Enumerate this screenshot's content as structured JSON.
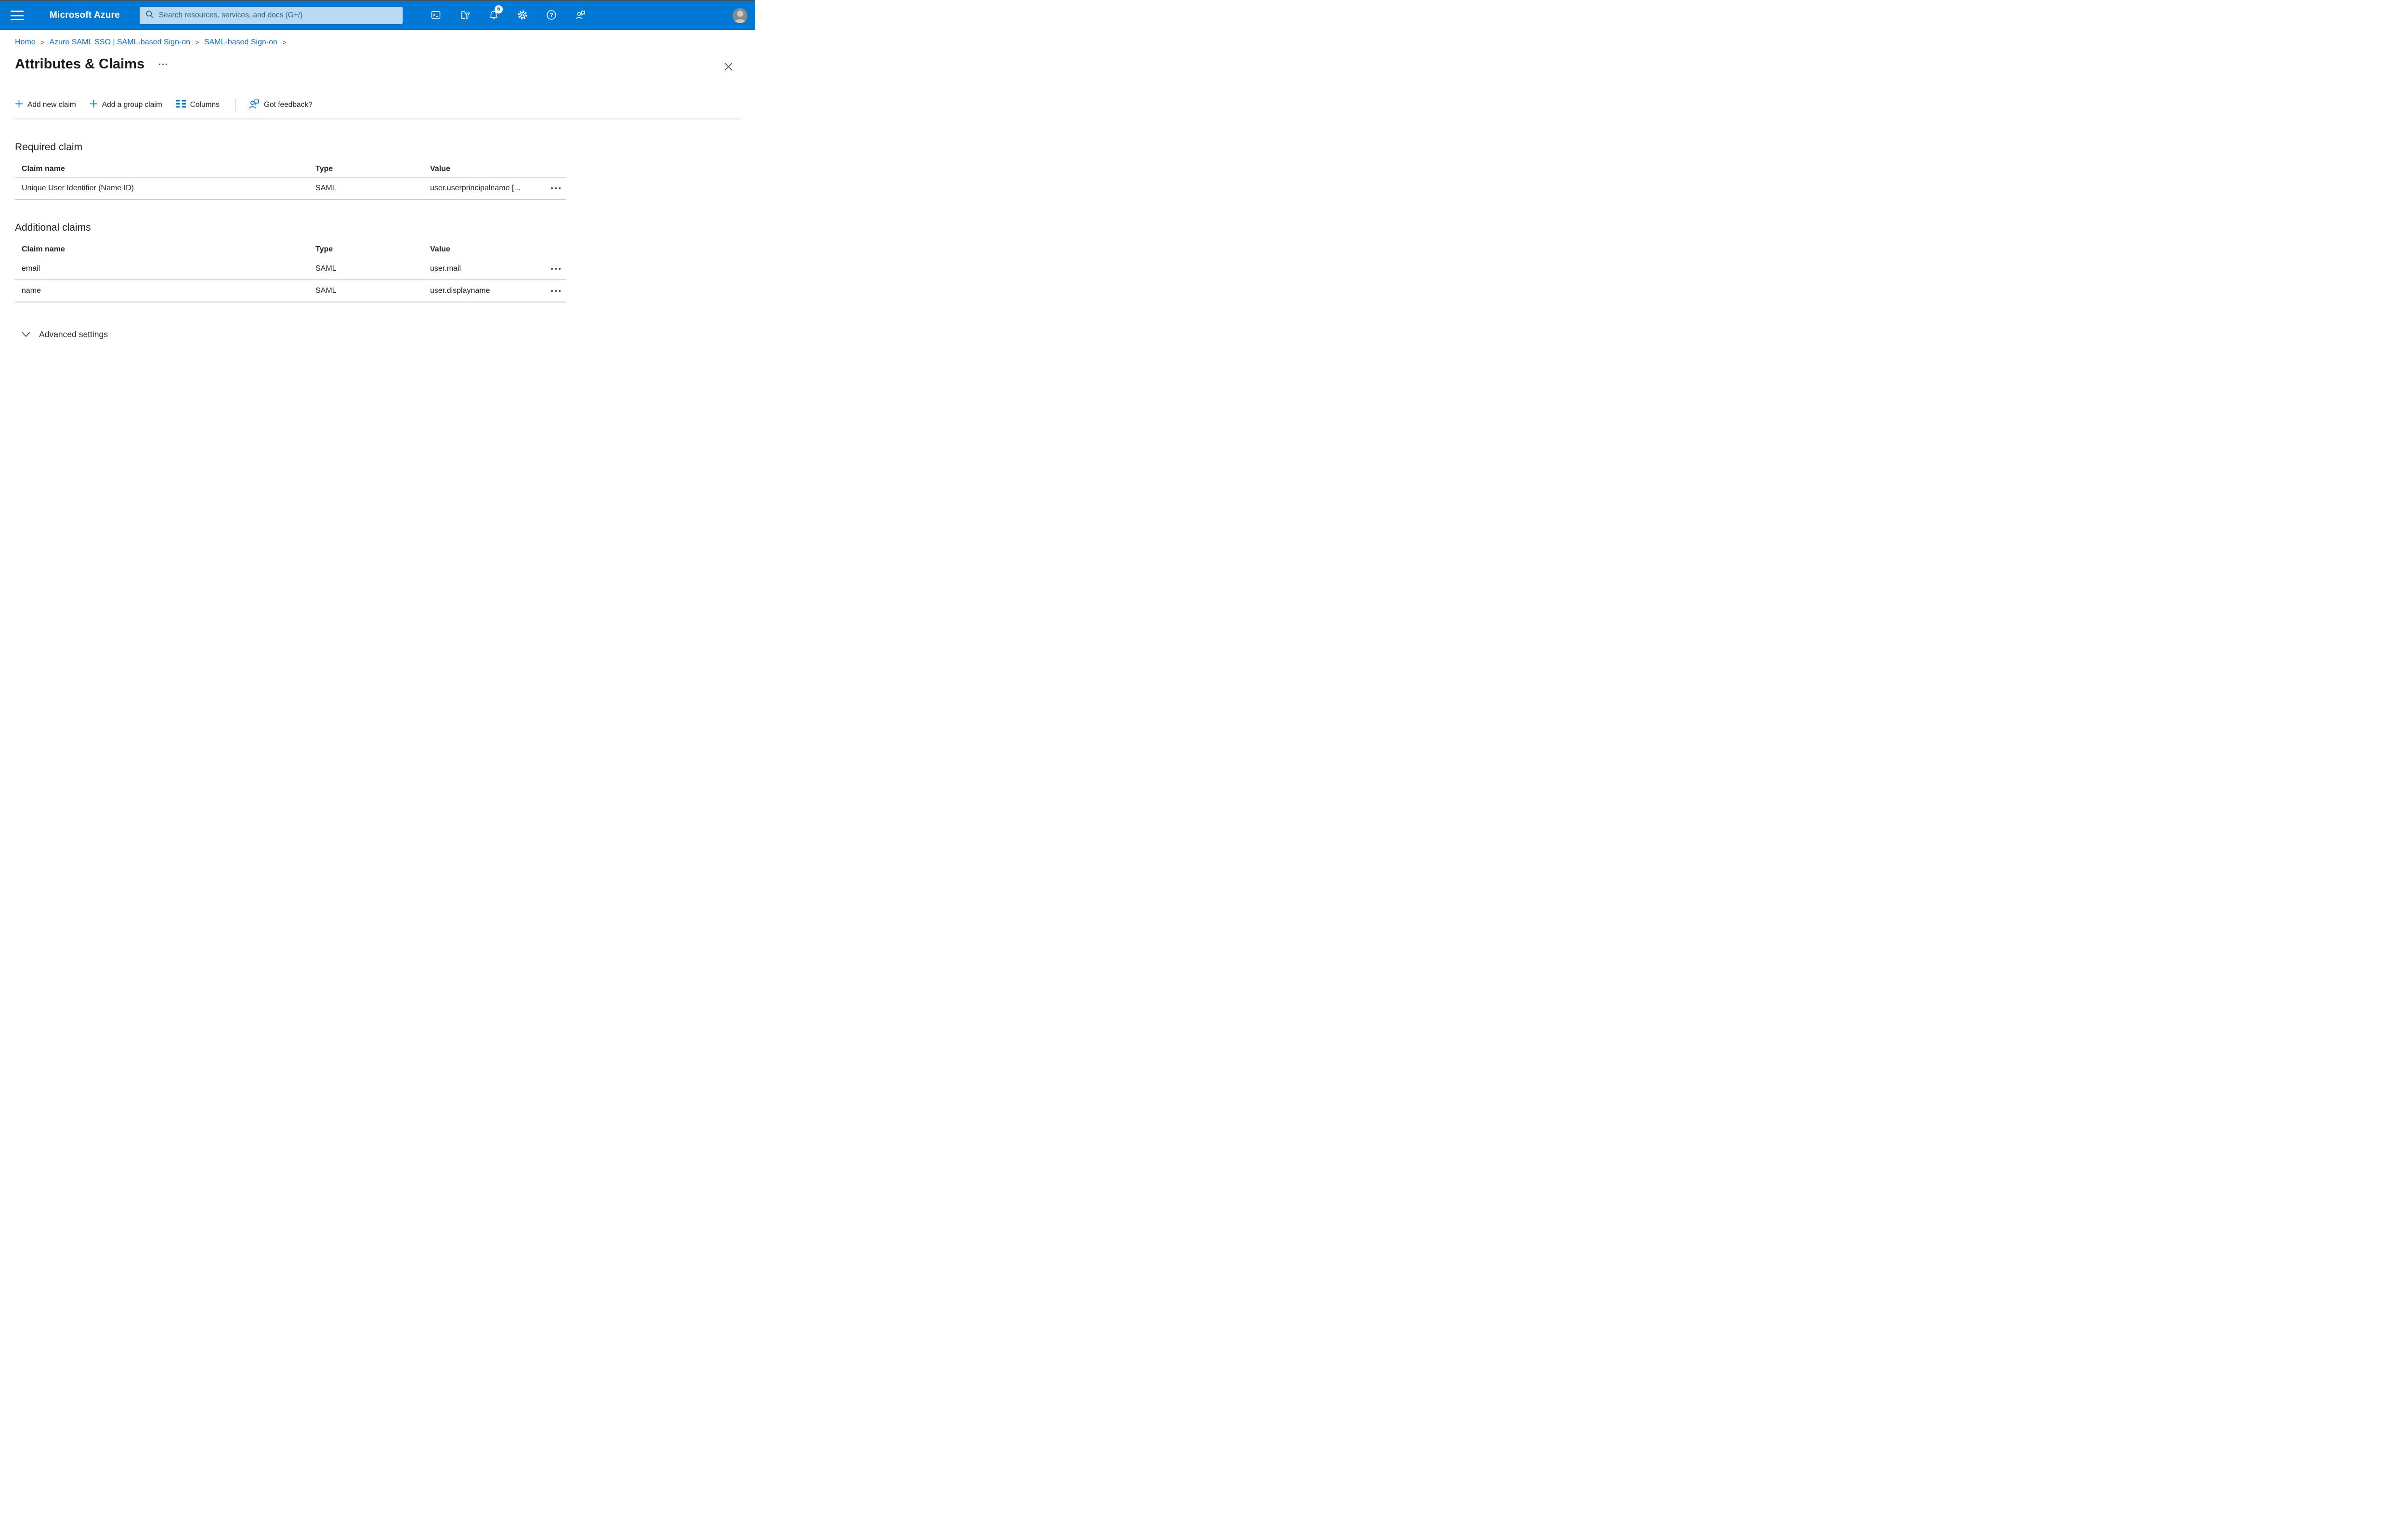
{
  "colors": {
    "topbar": "#0078d4",
    "accent": "#0078d4",
    "link": "#0b70cd",
    "search_background": "#bcd9f2",
    "search_text": "#2a5c86"
  },
  "topbar": {
    "brand": "Microsoft Azure",
    "search_placeholder": "Search resources, services, and docs (G+/)",
    "notification_count": "6",
    "icons": [
      "cloud-shell",
      "directory-filter",
      "notifications-bell",
      "settings-gear",
      "help",
      "feedback",
      "avatar"
    ]
  },
  "breadcrumb": {
    "separator": ">",
    "items": [
      {
        "label": "Home"
      },
      {
        "label": "Azure SAML SSO | SAML-based Sign-on"
      },
      {
        "label": "SAML-based Sign-on"
      }
    ]
  },
  "page": {
    "title": "Attributes & Claims"
  },
  "toolbar": {
    "add_new_claim": "Add new claim",
    "add_group_claim": "Add a group claim",
    "columns": "Columns",
    "got_feedback": "Got feedback?"
  },
  "sections": [
    {
      "heading": "Required claim",
      "columns": [
        "Claim name",
        "Type",
        "Value"
      ],
      "rows": [
        {
          "claim_name": "Unique User Identifier (Name ID)",
          "type": "SAML",
          "value": "user.userprincipalname [..."
        }
      ]
    },
    {
      "heading": "Additional claims",
      "columns": [
        "Claim name",
        "Type",
        "Value"
      ],
      "rows": [
        {
          "claim_name": "email",
          "type": "SAML",
          "value": "user.mail"
        },
        {
          "claim_name": "name",
          "type": "SAML",
          "value": "user.displayname"
        }
      ]
    }
  ],
  "advanced_settings": {
    "label": "Advanced settings"
  }
}
